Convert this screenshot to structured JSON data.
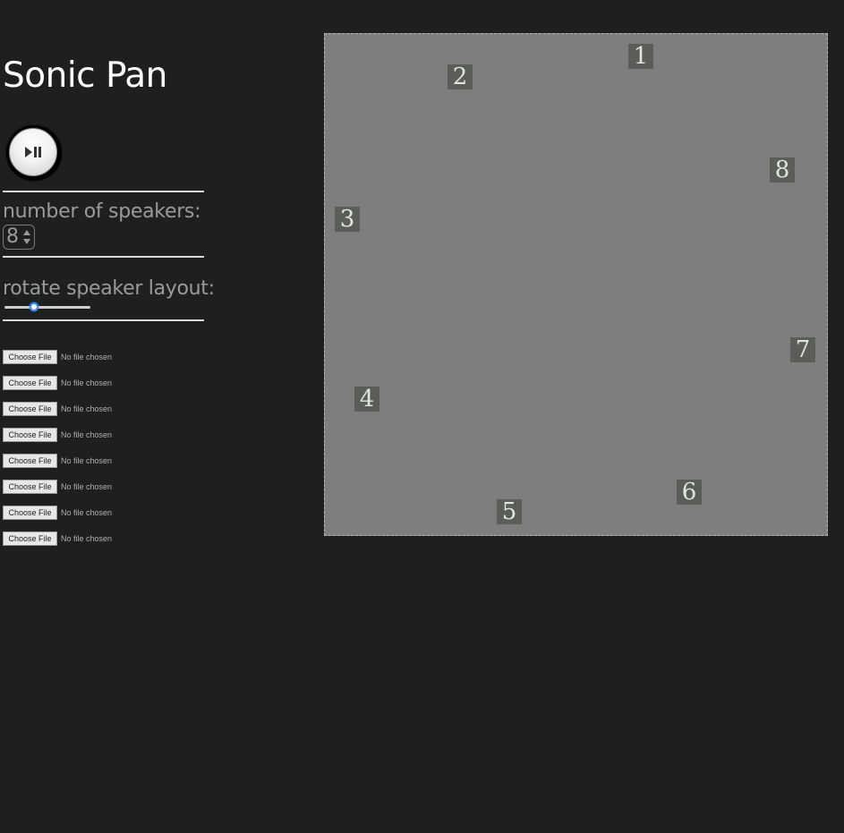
{
  "app": {
    "title": "Sonic Pan"
  },
  "controls": {
    "play_pause_icon": "play-pause-icon",
    "speaker_count_label": "number of speakers:",
    "speaker_count_value": "8",
    "rotate_label": "rotate speaker layout:",
    "rotate_value_fraction": 0.32
  },
  "files": [
    {
      "button_label": "Choose File",
      "status": "No file chosen"
    },
    {
      "button_label": "Choose File",
      "status": "No file chosen"
    },
    {
      "button_label": "Choose File",
      "status": "No file chosen"
    },
    {
      "button_label": "Choose File",
      "status": "No file chosen"
    },
    {
      "button_label": "Choose File",
      "status": "No file chosen"
    },
    {
      "button_label": "Choose File",
      "status": "No file chosen"
    },
    {
      "button_label": "Choose File",
      "status": "No file chosen"
    },
    {
      "button_label": "Choose File",
      "status": "No file chosen"
    }
  ],
  "speakers": [
    {
      "label": "1"
    },
    {
      "label": "2"
    },
    {
      "label": "3"
    },
    {
      "label": "4"
    },
    {
      "label": "5"
    },
    {
      "label": "6"
    },
    {
      "label": "7"
    },
    {
      "label": "8"
    }
  ],
  "colors": {
    "background": "#1e2020",
    "canvas": "#7e7e7e",
    "speaker_box": "#5b5e58",
    "slider_accent": "#3d8cff"
  }
}
